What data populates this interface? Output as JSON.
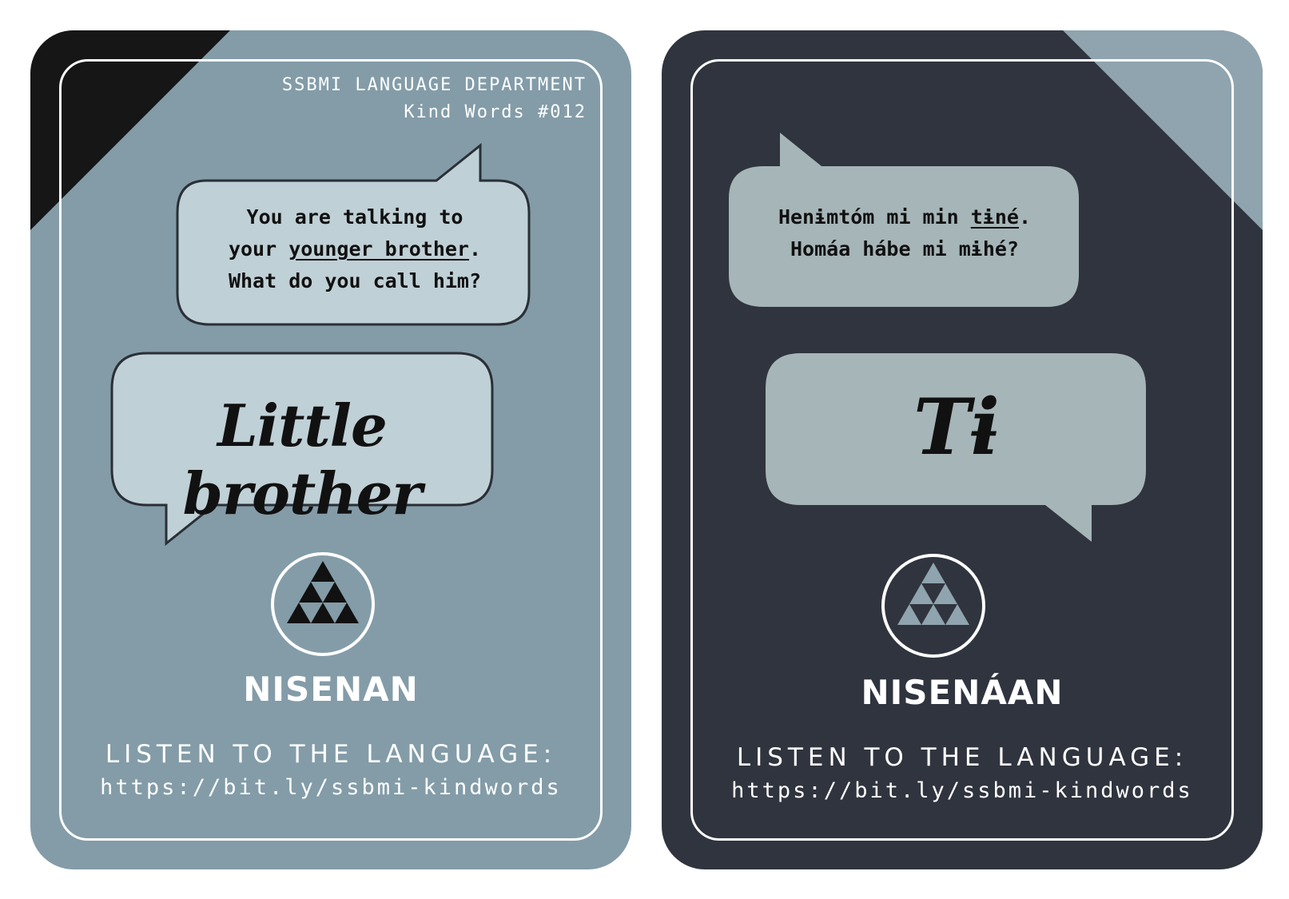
{
  "left_card": {
    "header_line1": "SSBMI LANGUAGE DEPARTMENT",
    "header_line2": "Kind Words #012",
    "prompt_line1": "You are talking to",
    "prompt_line2_pre": "your ",
    "prompt_line2_underlined": "younger brother",
    "prompt_line2_post": ".",
    "prompt_line3": "What do you call him?",
    "answer": "Little brother",
    "language_name": "NISENAN",
    "listen_label": "LISTEN TO THE LANGUAGE:",
    "url": "https://bit.ly/ssbmi-kindwords"
  },
  "right_card": {
    "prompt_line1_pre": "Henɨmtóm mi min ",
    "prompt_line1_underlined": "tɨné",
    "prompt_line1_post": ".",
    "prompt_line2": "Homáa hábe mi mɨhé?",
    "answer": "Tɨ",
    "language_name": "NISENÁAN",
    "listen_label": "LISTEN TO THE LANGUAGE:",
    "url": "https://bit.ly/ssbmi-kindwords"
  },
  "colors": {
    "left_card_bg": "#839ca8",
    "right_card_bg": "#30343e",
    "left_bubble": "#bfd0d6",
    "right_bubble": "#a6b5b8",
    "corner_dark": "#161616",
    "corner_light": "#8fa4ae",
    "frame": "#ffffff"
  },
  "icons": {
    "logo": "triangle-of-triangles-in-circle-icon"
  }
}
